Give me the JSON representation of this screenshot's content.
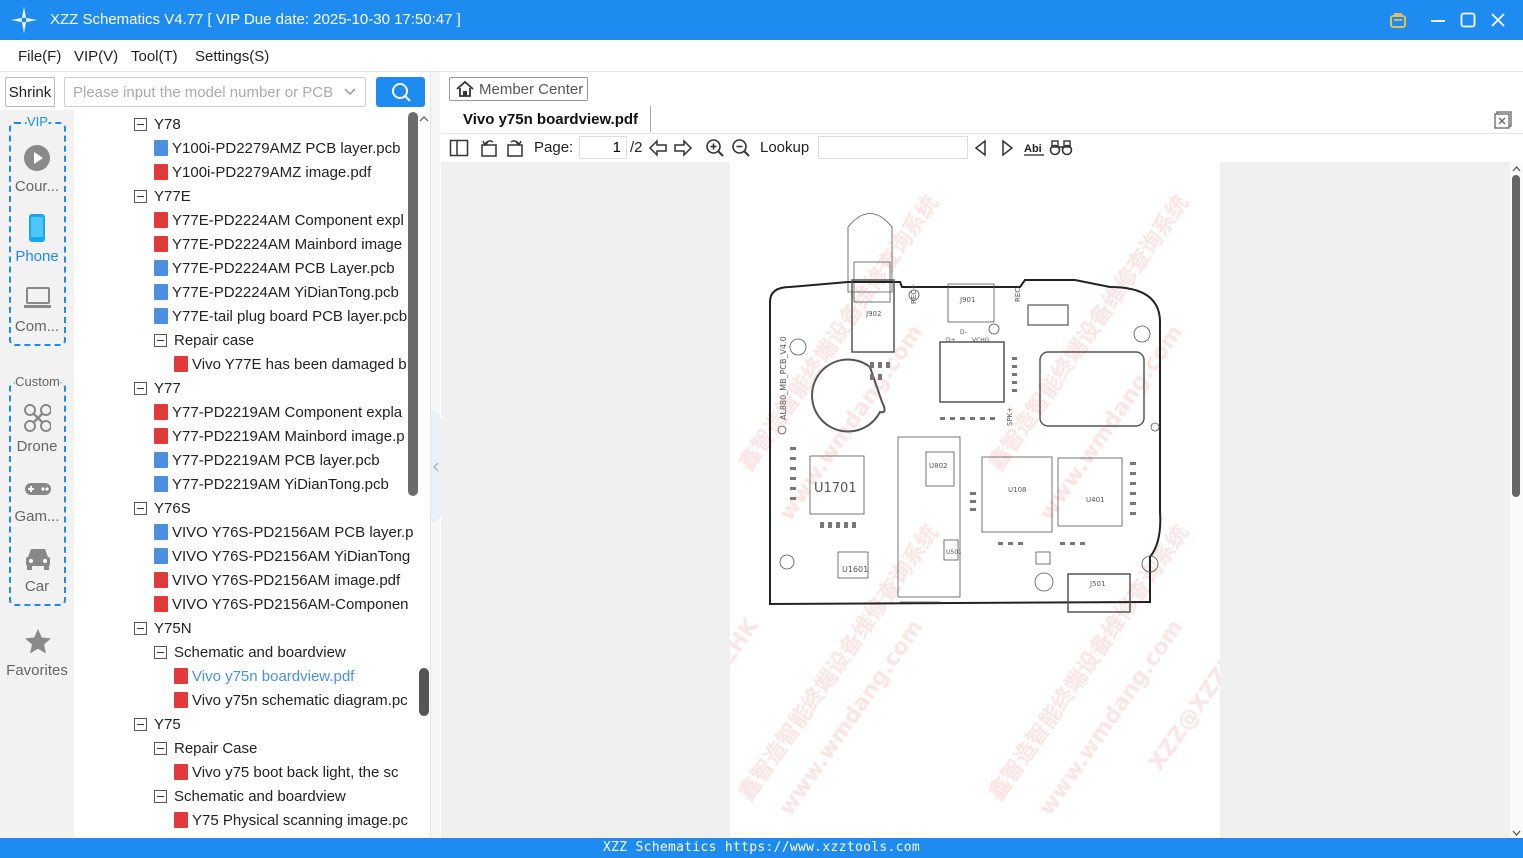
{
  "window": {
    "title": "XZZ Schematics V4.77 [ VIP Due date: 2025-10-30 17:50:47 ]"
  },
  "menu": [
    "File(F)",
    "VIP(V)",
    "Tool(T)",
    "Settings(S)"
  ],
  "search": {
    "shrink_label": "Shrink",
    "placeholder": "Please input the model number or PCB"
  },
  "sidebar": {
    "vip_label": "VIP",
    "custom_label": "Custom",
    "vip_items": [
      {
        "label": "Cour...",
        "icon": "play-icon",
        "active": false
      },
      {
        "label": "Phone",
        "icon": "phone-icon",
        "active": true
      },
      {
        "label": "Com...",
        "icon": "laptop-icon",
        "active": false
      }
    ],
    "custom_items": [
      {
        "label": "Drone",
        "icon": "drone-icon"
      },
      {
        "label": "Gam...",
        "icon": "gamepad-icon"
      },
      {
        "label": "Car",
        "icon": "car-icon"
      }
    ],
    "favorites_label": "Favorites"
  },
  "tree": [
    {
      "level": 0,
      "kind": "folder",
      "label": "Y78"
    },
    {
      "level": 1,
      "kind": "pcb",
      "label": "Y100i-PD2279AMZ PCB layer.pcb"
    },
    {
      "level": 1,
      "kind": "pdf",
      "label": "Y100i-PD2279AMZ image.pdf"
    },
    {
      "level": 0,
      "kind": "folder",
      "label": "Y77E"
    },
    {
      "level": 1,
      "kind": "pdf",
      "label": "Y77E-PD2224AM Component expl"
    },
    {
      "level": 1,
      "kind": "pdf",
      "label": "Y77E-PD2224AM Mainbord image"
    },
    {
      "level": 1,
      "kind": "pcb",
      "label": "Y77E-PD2224AM PCB Layer.pcb"
    },
    {
      "level": 1,
      "kind": "pcb",
      "label": "Y77E-PD2224AM YiDianTong.pcb"
    },
    {
      "level": 1,
      "kind": "pcb",
      "label": "Y77E-tail plug board PCB layer.pcb"
    },
    {
      "level": 1,
      "kind": "folder",
      "label": "Repair case"
    },
    {
      "level": 2,
      "kind": "pdf",
      "label": "Vivo Y77E has been damaged b"
    },
    {
      "level": 0,
      "kind": "folder",
      "label": "Y77"
    },
    {
      "level": 1,
      "kind": "pdf",
      "label": "Y77-PD2219AM Component expla"
    },
    {
      "level": 1,
      "kind": "pdf",
      "label": "Y77-PD2219AM Mainbord image.p"
    },
    {
      "level": 1,
      "kind": "pcb",
      "label": "Y77-PD2219AM PCB layer.pcb"
    },
    {
      "level": 1,
      "kind": "pcb",
      "label": "Y77-PD2219AM YiDianTong.pcb"
    },
    {
      "level": 0,
      "kind": "folder",
      "label": "Y76S"
    },
    {
      "level": 1,
      "kind": "pcb",
      "label": "VIVO Y76S-PD2156AM PCB layer.p"
    },
    {
      "level": 1,
      "kind": "pcb",
      "label": "VIVO Y76S-PD2156AM YiDianTong"
    },
    {
      "level": 1,
      "kind": "pdf",
      "label": "VIVO Y76S-PD2156AM image.pdf"
    },
    {
      "level": 1,
      "kind": "pdf",
      "label": "VIVO Y76S-PD2156AM-Componen"
    },
    {
      "level": 0,
      "kind": "folder",
      "label": "Y75N"
    },
    {
      "level": 1,
      "kind": "folder",
      "label": "Schematic and boardview"
    },
    {
      "level": 2,
      "kind": "pdf",
      "label": "Vivo y75n boardview.pdf",
      "selected": true
    },
    {
      "level": 2,
      "kind": "pdf",
      "label": "Vivo y75n schematic diagram.pc"
    },
    {
      "level": 0,
      "kind": "folder",
      "label": "Y75"
    },
    {
      "level": 1,
      "kind": "folder",
      "label": "Repair Case"
    },
    {
      "level": 2,
      "kind": "pdf",
      "label": "Vivo y75 boot back light, the sc"
    },
    {
      "level": 1,
      "kind": "folder",
      "label": "Schematic and boardview"
    },
    {
      "level": 2,
      "kind": "pdf",
      "label": "Y75 Physical scanning image.pc"
    }
  ],
  "viewer": {
    "member_center": "Member Center",
    "tab_title": "Vivo y75n boardview.pdf",
    "page_label": "Page:",
    "page_current": "1",
    "page_total": "/2",
    "lookup_label": "Lookup",
    "lookup_value": ""
  },
  "board": {
    "labels": {
      "board_id": "AL880_MB_PCB_V4.0",
      "u1701": "U1701",
      "u1601": "U1601",
      "u401": "U401",
      "u108": "U108",
      "u802": "U802",
      "j501": "J501",
      "j901": "J901",
      "j902": "J902",
      "u501": "U501",
      "vchg": "VCHG",
      "rec_plus": "REC+",
      "rec_minus": "REC-",
      "spk": "SPK+",
      "d_plus": "D+",
      "d_minus": "D-"
    },
    "watermarks": [
      "XZZ@XZZHK",
      "www.wmdang.com",
      "鑫智造智能终端设备维修查询系统"
    ]
  },
  "statusbar": "XZZ Schematics https://www.xzztools.com",
  "colors": {
    "accent": "#1e8bf0",
    "pdf_icon": "#e03a3a",
    "pcb_icon": "#4a8fe0",
    "selected_text": "#4a8fe8"
  }
}
